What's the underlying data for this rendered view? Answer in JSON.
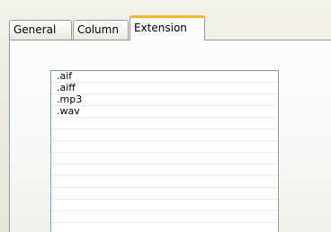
{
  "tabs": [
    {
      "label": "General",
      "selected": false
    },
    {
      "label": "Column",
      "selected": false
    },
    {
      "label": "Extension",
      "selected": true
    }
  ],
  "active_tab_accent": "#f8b330",
  "extensions": [
    ".aif",
    ".aiff",
    ".mp3",
    ".wav",
    "",
    "",
    "",
    "",
    "",
    "",
    "",
    "",
    "",
    ""
  ]
}
